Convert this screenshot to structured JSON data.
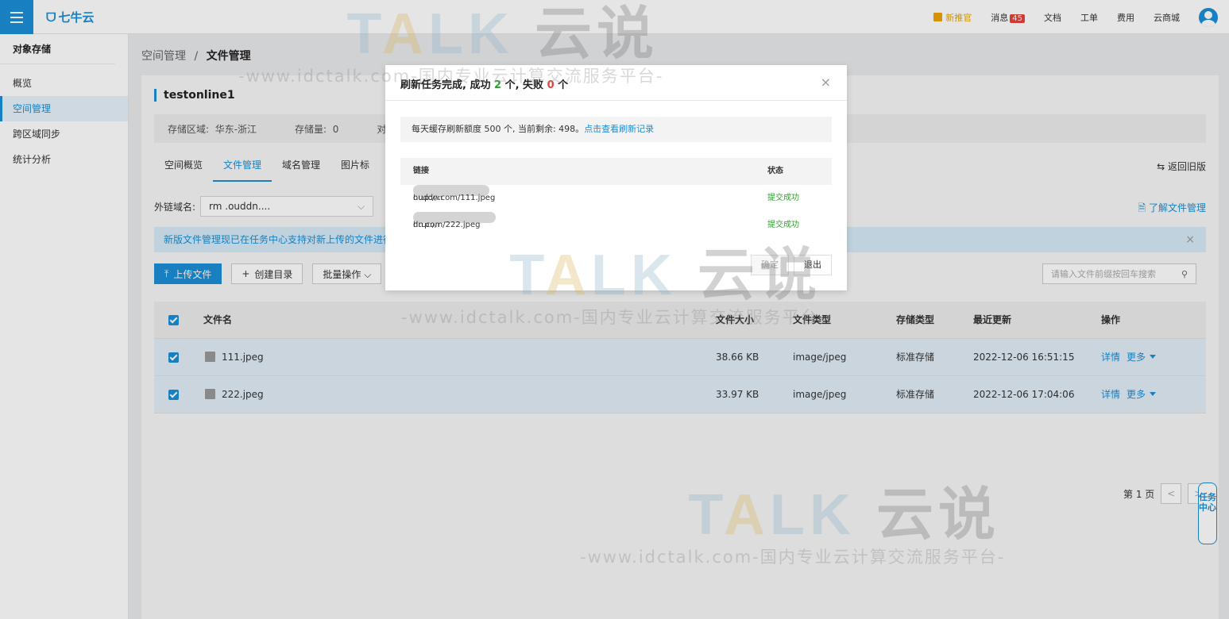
{
  "topbar": {
    "logo": "七牛云",
    "nav": {
      "promo": "新推官",
      "messages": "消息",
      "messages_count": "45",
      "docs": "文档",
      "tickets": "工单",
      "billing": "费用",
      "market": "云商城"
    }
  },
  "sidebar": {
    "title": "对象存储",
    "items": [
      {
        "label": "概览"
      },
      {
        "label": "空间管理"
      },
      {
        "label": "跨区域同步"
      },
      {
        "label": "统计分析"
      }
    ]
  },
  "breadcrumb": {
    "parent": "空间管理",
    "sep": "/",
    "current": "文件管理"
  },
  "bucket": {
    "name": "testonline1",
    "region_label": "存储区域:",
    "region": "华东-浙江",
    "size_label": "存储量:",
    "size": "0",
    "extra": "对"
  },
  "tabs": [
    {
      "label": "空间概览"
    },
    {
      "label": "文件管理"
    },
    {
      "label": "域名管理"
    },
    {
      "label": "图片标"
    }
  ],
  "revert": "⇆ 返回旧版",
  "domain": {
    "label": "外链域名:",
    "value": "rm                        .ouddn....",
    "arrow": "⌵"
  },
  "learn": "了解文件管理",
  "notice": {
    "text": "新版文件管理现已在任务中心支持对新上传的文件进行复",
    "close": "×"
  },
  "actions": {
    "upload": "上传文件",
    "mkdir": "创建目录",
    "batch": "批量操作 ⌵"
  },
  "search": {
    "placeholder": "请输入文件前缀按回车搜索"
  },
  "table": {
    "headers": {
      "name": "文件名",
      "size": "文件大小",
      "type": "文件类型",
      "storage": "存储类型",
      "updated": "最近更新",
      "ops": "操作"
    },
    "rows": [
      {
        "name": "111.jpeg",
        "size": "38.66 KB",
        "type": "image/jpeg",
        "storage": "标准存储",
        "updated": "2022-12-06 16:51:15",
        "detail": "详情",
        "more": "更多"
      },
      {
        "name": "222.jpeg",
        "size": "33.97 KB",
        "type": "image/jpeg",
        "storage": "标准存储",
        "updated": "2022-12-06 17:04:06",
        "detail": "详情",
        "more": "更多"
      }
    ]
  },
  "pager": {
    "label": "第 1 页",
    "prev": "<",
    "next": ">"
  },
  "task_center": "任务中心",
  "modal": {
    "title_prefix": "刷新任务完成, 成功 ",
    "success_count": "2",
    "title_mid": " 个, 失败 ",
    "fail_count": "0",
    "title_suffix": " 个",
    "close": "×",
    "info": "每天缓存刷新额度 500 个, 当前剩余: 498。",
    "info_link": "点击查看刷新记录",
    "col_link": "链接",
    "col_status": "状态",
    "rows": [
      {
        "url_start": "http://n",
        "url_end": "ouddn.com/111.jpeg",
        "status": "提交成功"
      },
      {
        "url_start": "http://r",
        "url_end": "dn.com/222.jpeg",
        "status": "提交成功"
      }
    ],
    "confirm": "确定",
    "exit": "退出"
  },
  "watermark": {
    "brand_a": "T",
    "brand_b": "A",
    "brand_c": "LK",
    "brand_cn": "云说",
    "tagline": "-www.idctalk.com-国内专业云计算交流服务平台-"
  },
  "colors": {
    "accent": "#1b8fd6",
    "success": "#2ca02c",
    "danger": "#e0443a"
  }
}
